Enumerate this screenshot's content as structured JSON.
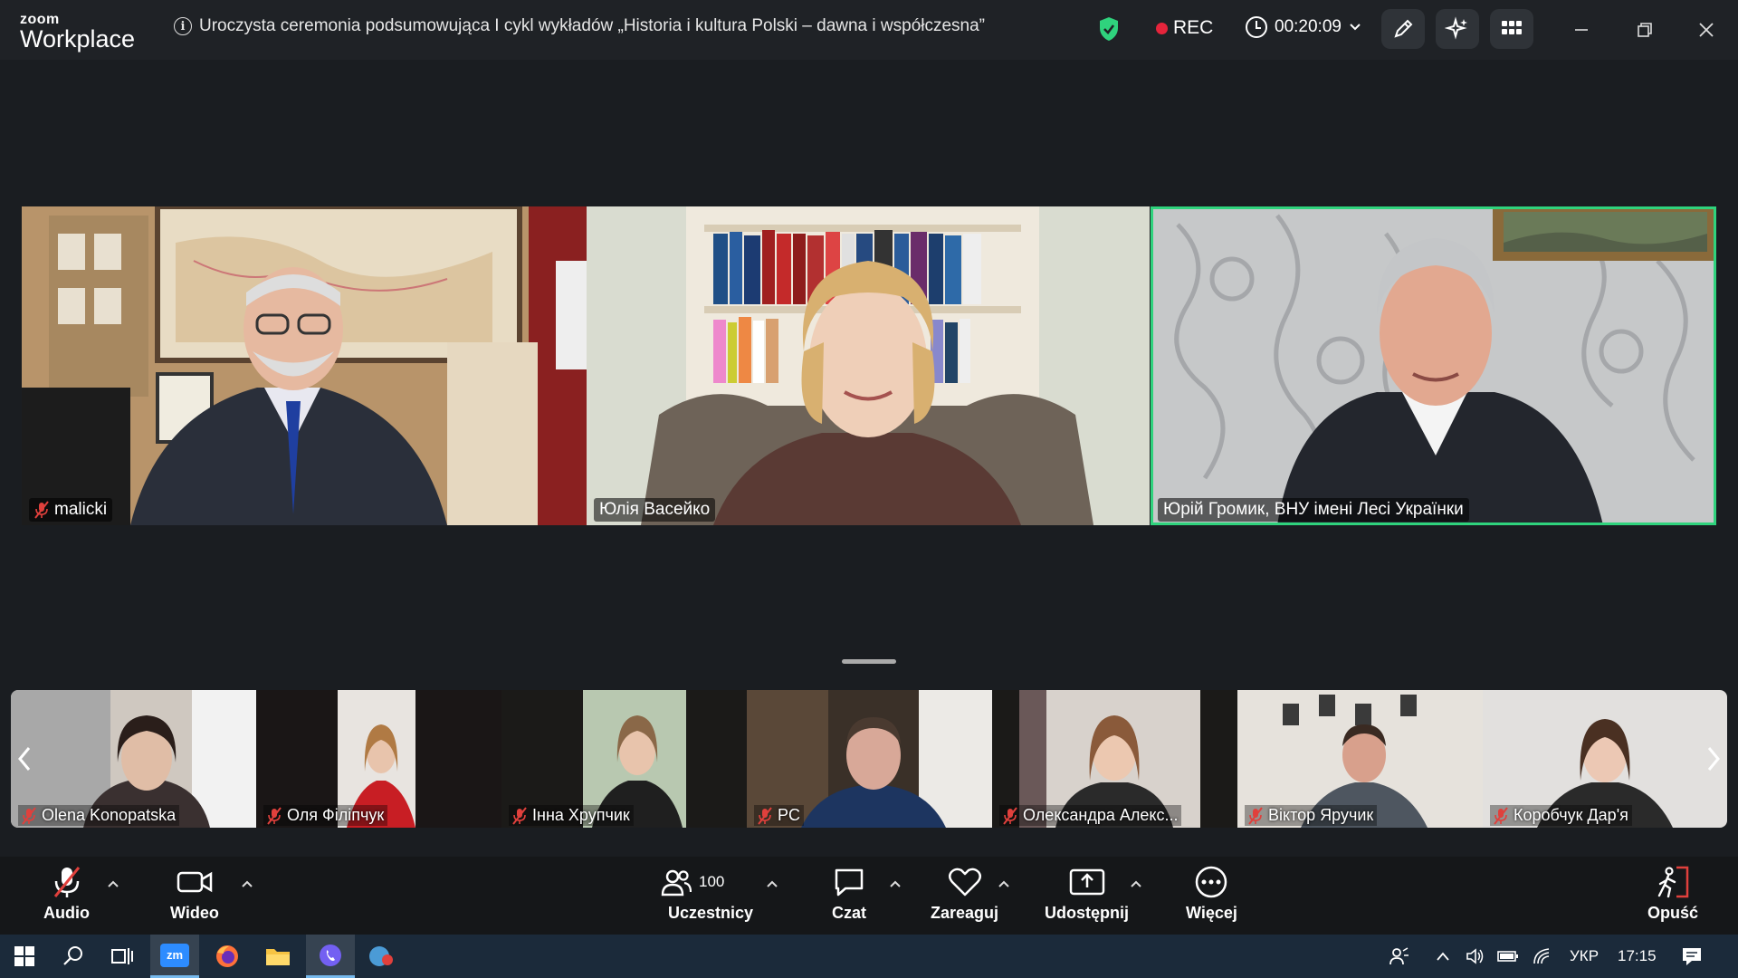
{
  "app": {
    "logo_small": "zoom",
    "logo_big": "Workplace"
  },
  "meeting": {
    "title": "Uroczysta ceremonia podsumowująca I cykl wykładów „Historia i kultura Polski – dawna i współczesna”",
    "rec_label": "REC",
    "timer": "00:20:09"
  },
  "main_tiles": [
    {
      "name": "malicki",
      "muted": true
    },
    {
      "name": "Юлія Васейко",
      "muted": false
    },
    {
      "name": "Юрій Громик, ВНУ імені Лесі Українки",
      "muted": false,
      "active": true
    }
  ],
  "strip": [
    {
      "name": "Olena Konopatska"
    },
    {
      "name": "Оля Філіпчук"
    },
    {
      "name": "Інна Хрупчик"
    },
    {
      "name": "PC"
    },
    {
      "name": "Олександра Алекс..."
    },
    {
      "name": "Віктор Яручик"
    },
    {
      "name": "Коробчук Дар'я"
    }
  ],
  "toolbar": {
    "audio": "Audio",
    "video": "Wideo",
    "participants": "Uczestnicy",
    "participants_count": "100",
    "chat": "Czat",
    "react": "Zareaguj",
    "share": "Udostępnij",
    "more": "Więcej",
    "leave": "Opuść"
  },
  "taskbar": {
    "lang": "УКР",
    "time": "17:15",
    "zoom_label": "zm"
  },
  "colors": {
    "active_speaker": "#2fd37d",
    "rec_dot": "#e5243b",
    "muted": "#e0403c"
  }
}
